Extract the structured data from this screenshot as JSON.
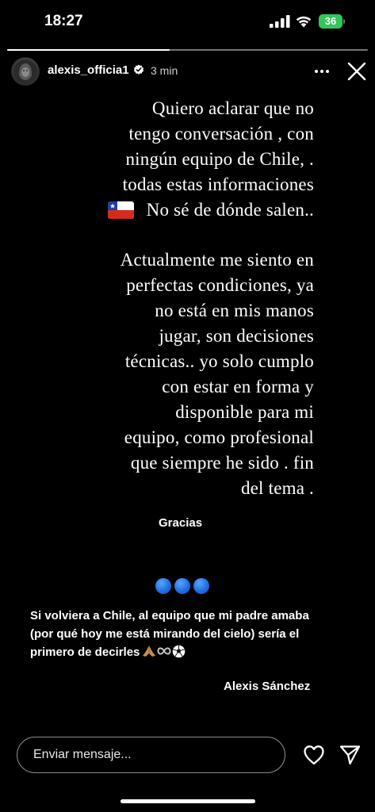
{
  "status_bar": {
    "time": "18:27",
    "battery": "36",
    "battery_color": "#32c759",
    "icons": [
      "signal-icon",
      "wifi-icon",
      "battery-icon"
    ]
  },
  "story": {
    "progress": 0.45,
    "username": "alexis_officia1",
    "verified": true,
    "time_ago": "3 min",
    "header_icons": [
      "more-icon",
      "close-icon"
    ],
    "paragraph1": [
      "Quiero aclarar que no",
      "tengo conversación , con",
      "ningún equipo de Chile, .",
      "todas estas informaciones",
      "No sé de dónde salen.."
    ],
    "paragraph2": [
      "Actualmente me siento en",
      "perfectas condiciones, ya",
      "no está en mis manos",
      "jugar, son  decisiones",
      "técnicas..  yo solo cumplo",
      "con estar en forma y",
      "disponible para mi",
      "equipo, como profesional",
      "que siempre he sido . fin",
      "del tema ."
    ],
    "flag": "chile-flag-icon",
    "gracias": "Gracias",
    "dots_color": "#1f6fe0",
    "quote": [
      "Si volviera a Chile, al equipo que mi padre amaba",
      "(por qué hoy me está mirando del  cielo) sería el",
      "primero de decirles"
    ],
    "quote_emojis": [
      "praying-hands-icon",
      "infinity-icon",
      "soccer-ball-icon"
    ],
    "signature": "Alexis Sánchez"
  },
  "reply_bar": {
    "placeholder": "Enviar mensaje...",
    "icons": [
      "heart-icon",
      "send-icon"
    ]
  }
}
